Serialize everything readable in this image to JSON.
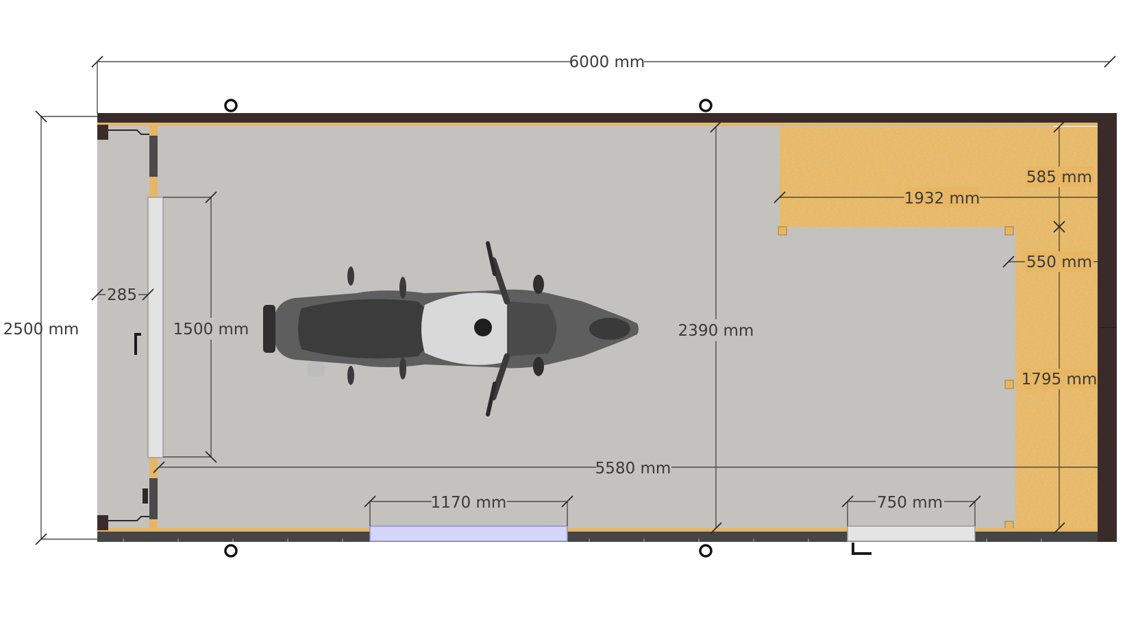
{
  "dimensions": {
    "total_length": "6000 mm",
    "total_width": "2500 mm",
    "door_opening": "1500 mm",
    "door_offset": "285",
    "interior_width": "2390 mm",
    "interior_length": "5580 mm",
    "window_left": "1170 mm",
    "window_right": "750 mm",
    "shelf_length": "1932 mm",
    "shelf_depth_top": "585 mm",
    "shelf_depth_side": "550 mm",
    "shelf_side_length": "1795 mm"
  },
  "colors": {
    "wall": "#3a2b2b",
    "floor": "#c2c0bc",
    "shelf": "#e6b45e",
    "window_glass": "#d4d7fb",
    "window_frame": "#8b8fd8"
  }
}
